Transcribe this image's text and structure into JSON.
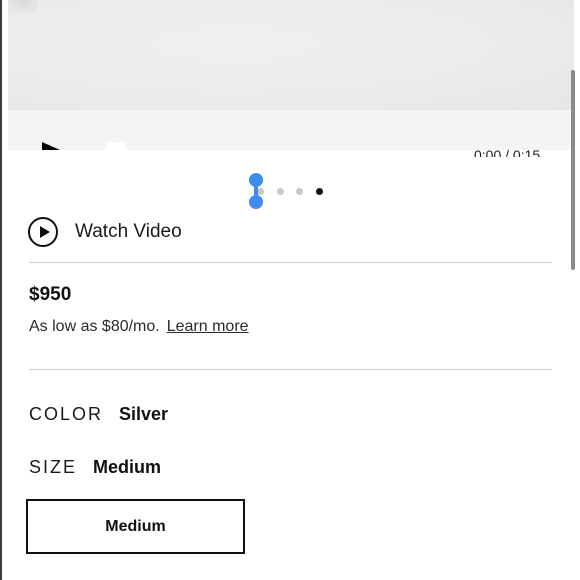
{
  "video": {
    "time": "0:00 / 0:15"
  },
  "carousel": {
    "dot_count": 4,
    "active_index": 3
  },
  "watch_video": {
    "label": "Watch Video",
    "icon": "play-circle-icon"
  },
  "pricing": {
    "price": "$950",
    "finance_text": "As low as $80/mo.",
    "learn_more": "Learn more"
  },
  "options": {
    "color_label": "COLOR",
    "color_value": "Silver",
    "size_label": "SIZE",
    "size_value": "Medium",
    "size_choices": [
      "Medium"
    ]
  },
  "colors": {
    "accent_handle": "#3f8cf0",
    "text": "#111111",
    "divider": "#cfcfcf"
  }
}
